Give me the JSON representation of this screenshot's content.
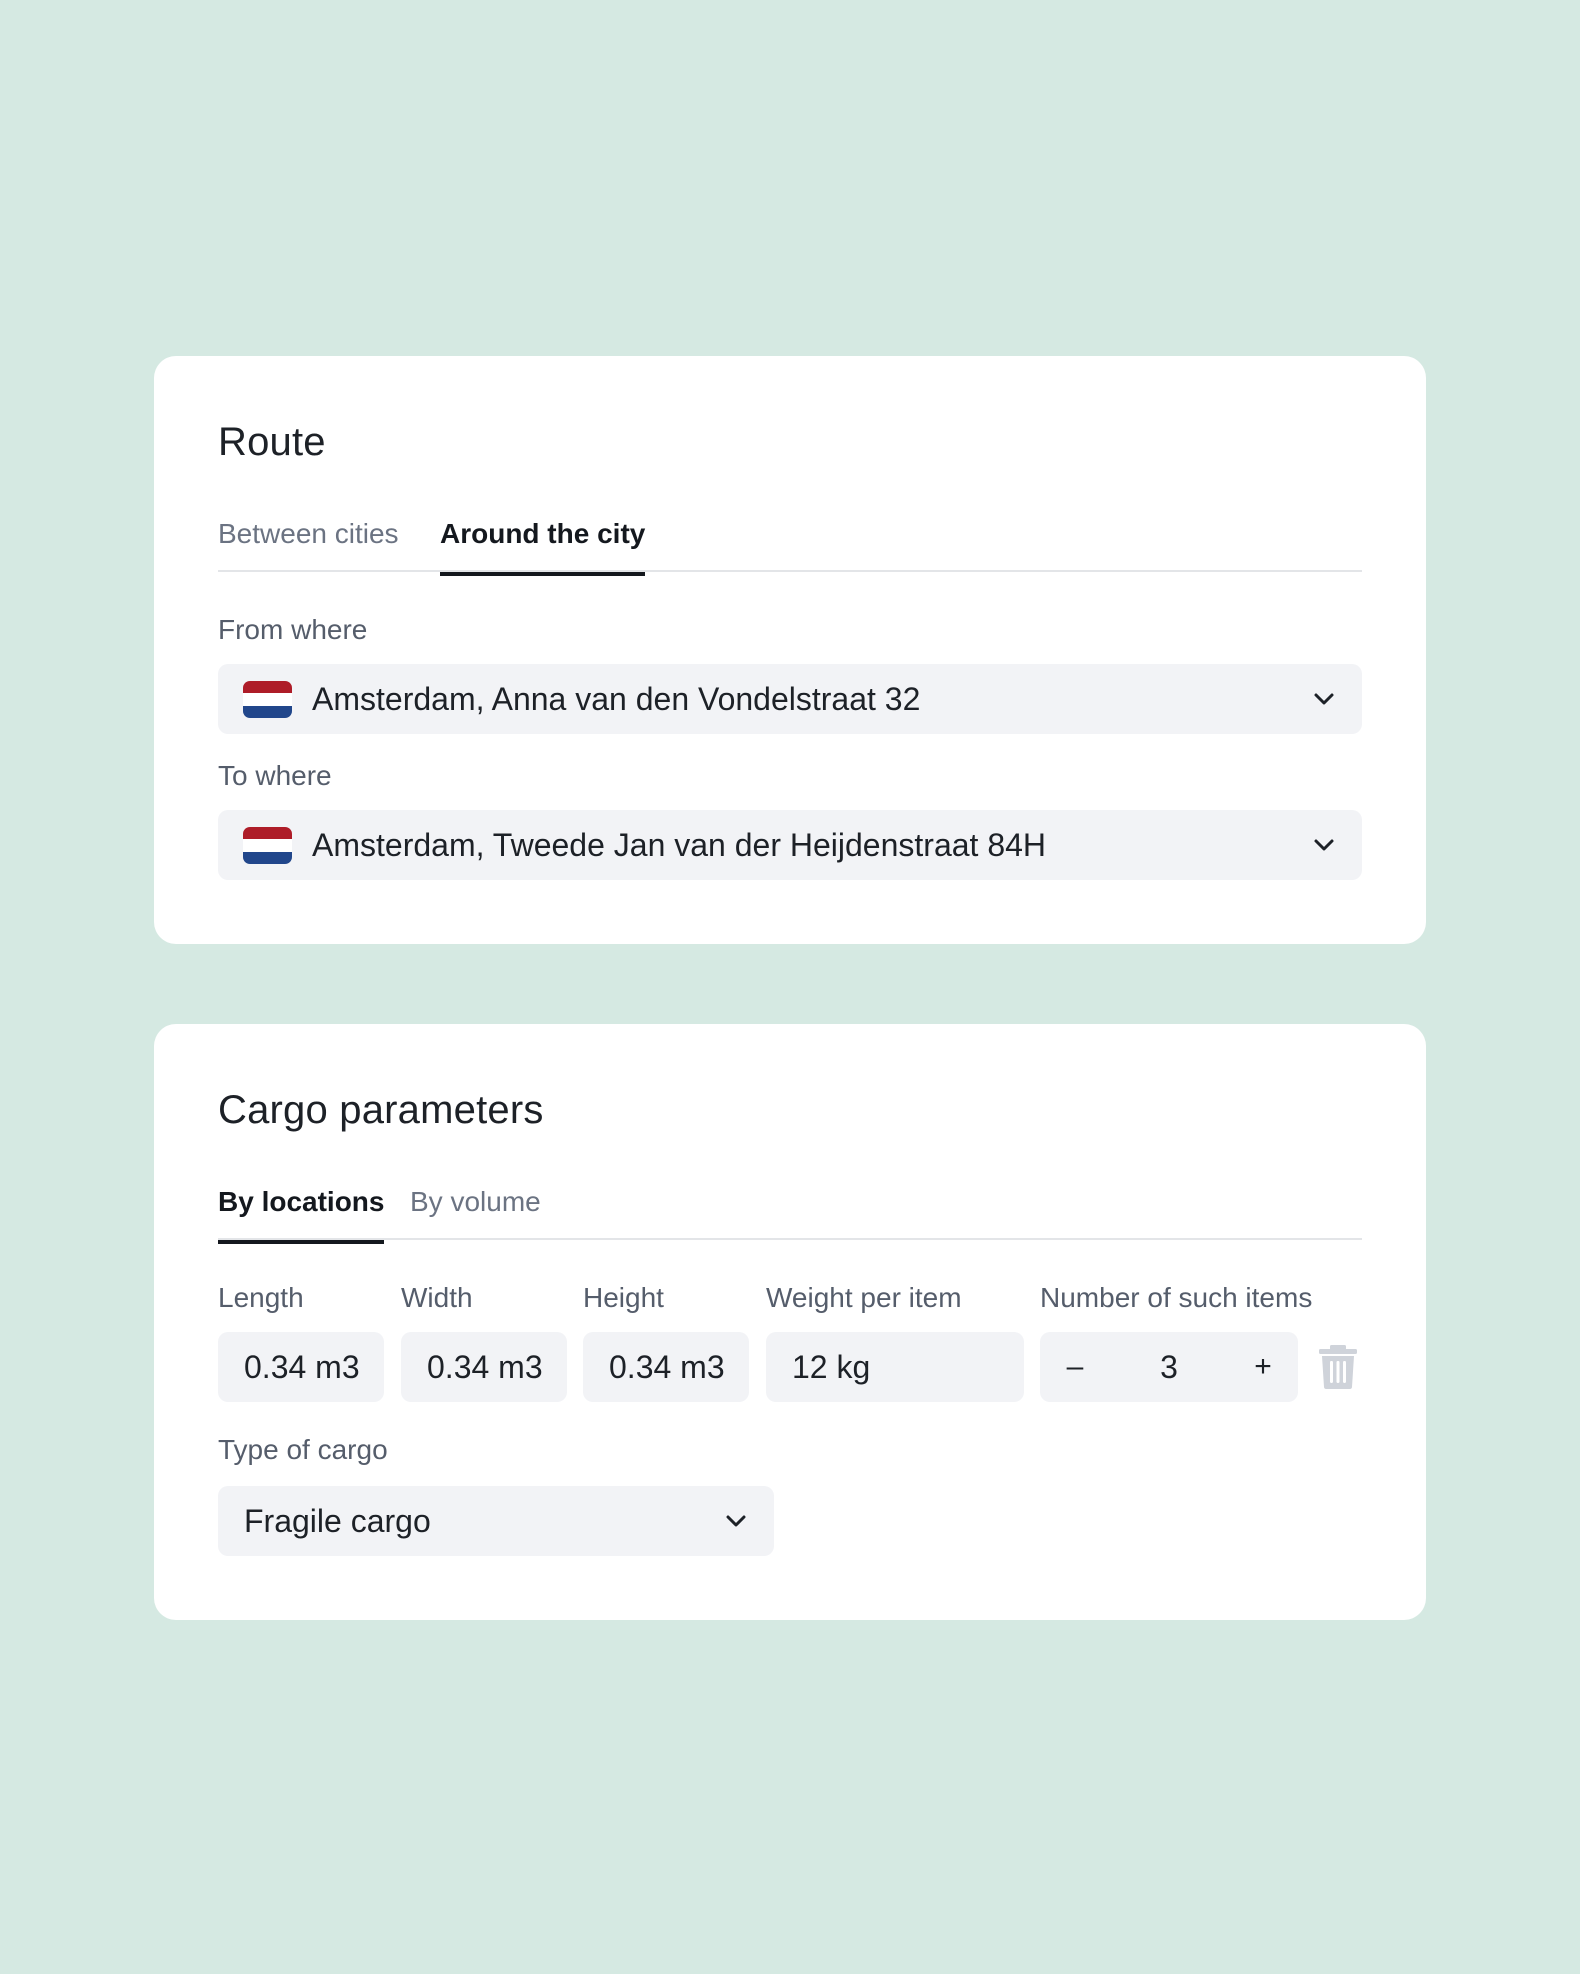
{
  "route": {
    "title": "Route",
    "tabs": [
      {
        "label": "Between cities",
        "active": false
      },
      {
        "label": "Around the city",
        "active": true
      }
    ],
    "from": {
      "label": "From where",
      "value": "Amsterdam, Anna van den Vondelstraat 32",
      "flag": "netherlands-flag-icon"
    },
    "to": {
      "label": "To where",
      "value": "Amsterdam, Tweede Jan van der Heijdenstraat 84H",
      "flag": "netherlands-flag-icon"
    }
  },
  "cargo": {
    "title": "Cargo parameters",
    "tabs": [
      {
        "label": "By locations",
        "active": true
      },
      {
        "label": "By volume",
        "active": false
      }
    ],
    "fields": {
      "length": {
        "label": "Length",
        "value": "0.34 m3"
      },
      "width": {
        "label": "Width",
        "value": "0.34 m3"
      },
      "height": {
        "label": "Height",
        "value": "0.34 m3"
      },
      "weight": {
        "label": "Weight per item",
        "value": "12 kg"
      },
      "quantity": {
        "label": "Number of such items",
        "value": "3",
        "minus": "–",
        "plus": "+"
      }
    },
    "type": {
      "label": "Type of cargo",
      "value": "Fragile cargo"
    }
  },
  "icons": {
    "chevron": "chevron-down-icon",
    "trash": "trash-icon"
  },
  "colors": {
    "background": "#d5e9e2",
    "card": "#ffffff",
    "field": "#f2f3f6",
    "active_tab": "#14181e",
    "inactive_tab": "#6b7382",
    "flag_red": "#ae1c28",
    "flag_blue": "#21468b"
  }
}
